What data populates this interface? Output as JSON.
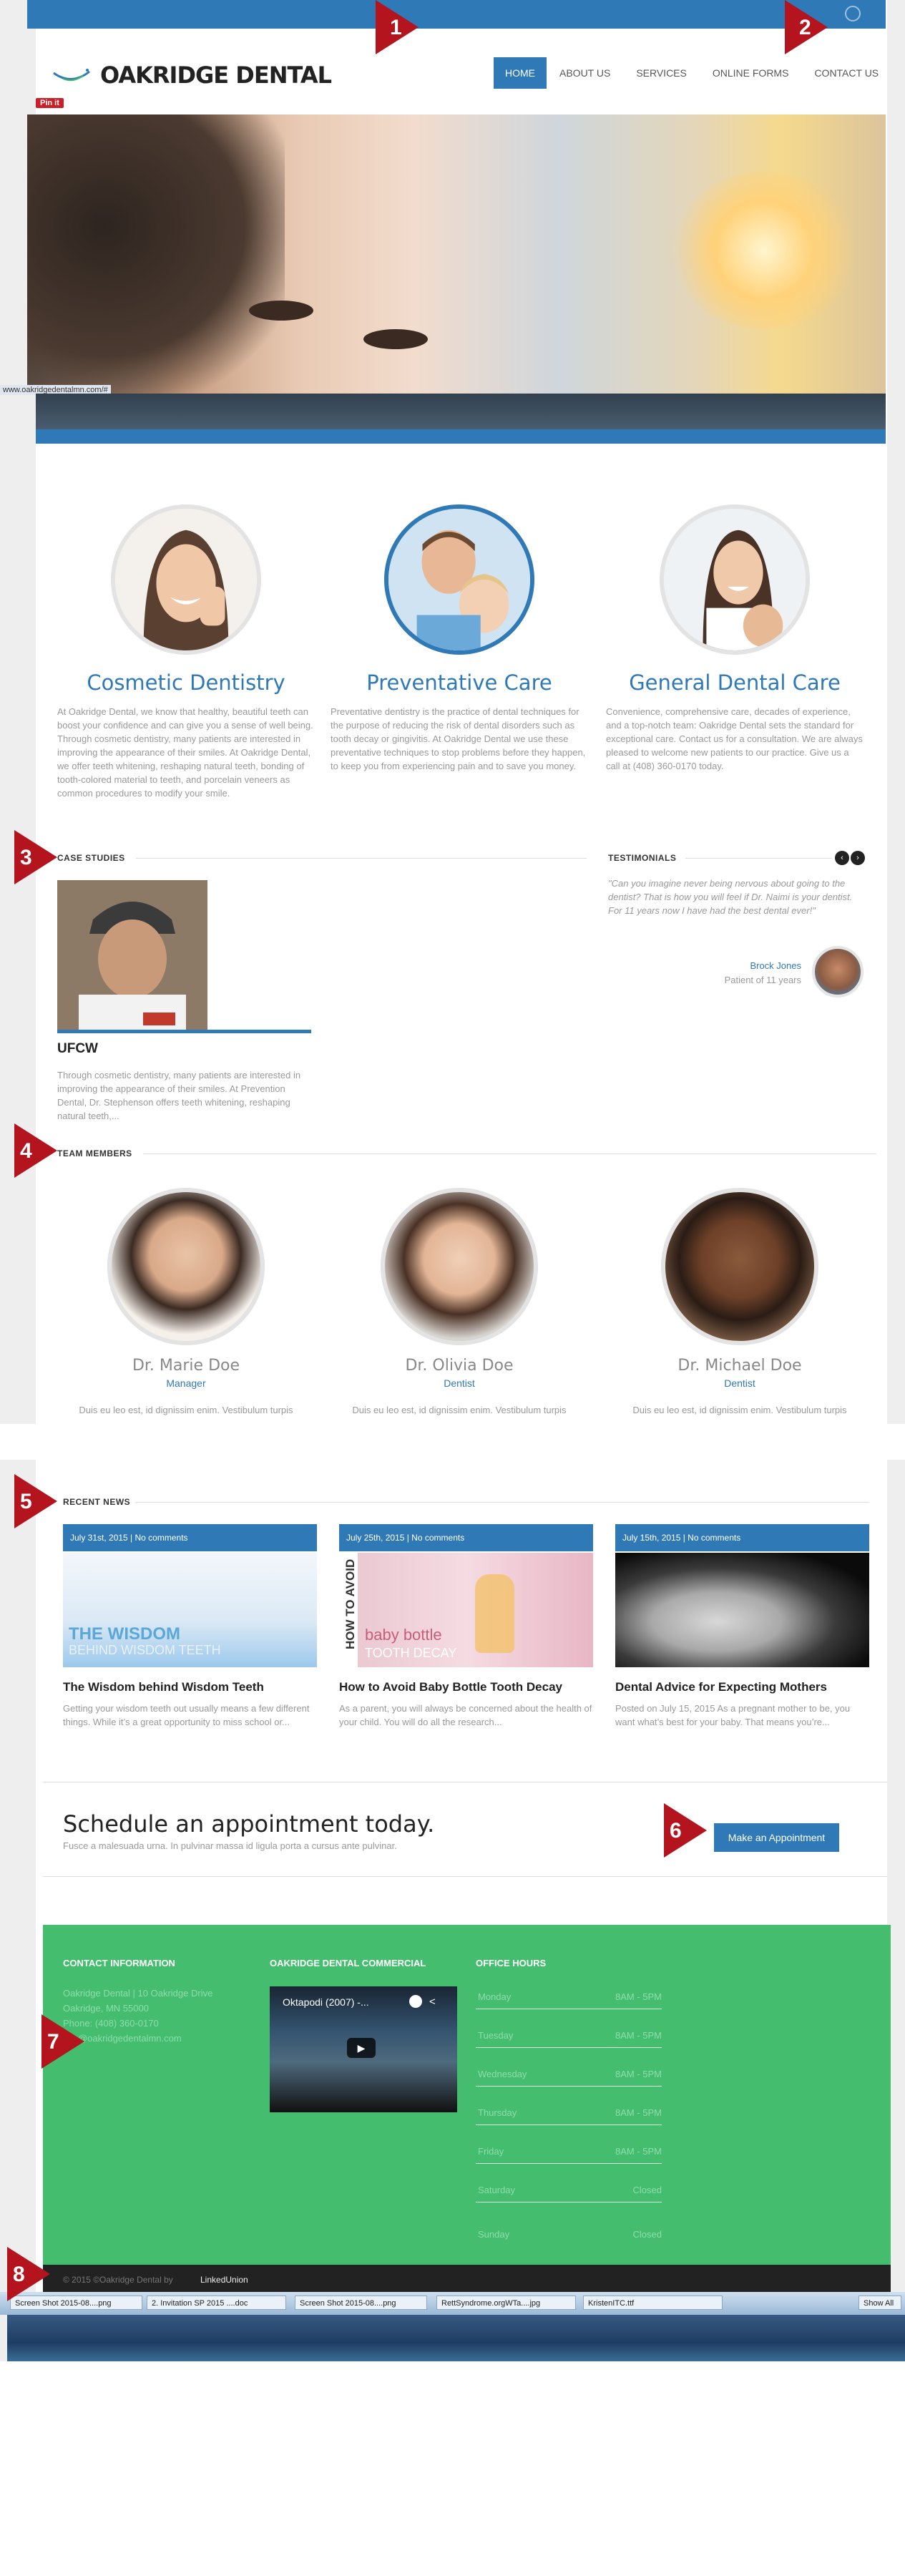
{
  "site": {
    "logo_text": "OAKRIDGE DENTAL",
    "pinit_label": "Pin it"
  },
  "nav": [
    "HOME",
    "ABOUT US",
    "SERVICES",
    "ONLINE FORMS",
    "CONTACT US"
  ],
  "status_url": "www.oakridgedentalmn.com/#",
  "services": [
    {
      "title": "Cosmetic Dentistry",
      "text": "At Oakridge Dental, we know that healthy, beautiful teeth can boost your confidence and can give you a sense of well being. Through cosmetic dentistry, many patients are interested in improving the appearance of their smiles. At Oakridge Dental, we offer teeth whitening, reshaping natural teeth, bonding of tooth-colored material to teeth, and porcelain veneers as common procedures to modify your smile."
    },
    {
      "title": "Preventative Care",
      "text": "Preventative dentistry is the practice of dental techniques for the purpose of reducing the risk of dental disorders such as tooth decay or gingivitis. At Oakridge Dental we use these preventative techniques to stop problems before they happen, to keep you from experiencing pain and to save you money."
    },
    {
      "title": "General Dental Care",
      "text": "Convenience, comprehensive care, decades of experience, and a top-notch team: Oakridge Dental sets the standard for exceptional care. Contact us for a consultation. We are always pleased to welcome new patients to our practice. Give us a call at (408) 360-0170 today."
    }
  ],
  "case_studies": {
    "heading": "CASE STUDIES",
    "title": "UFCW",
    "text": "Through cosmetic dentistry, many patients are interested in improving the appearance of their smiles. At Prevention Dental, Dr. Stephenson offers teeth whitening, reshaping natural teeth,..."
  },
  "testimonials": {
    "heading": "TESTIMONIALS",
    "quote": "\"Can you imagine never being nervous about going to the dentist? That is how you will feel if Dr. Naimi is your dentist. For 11 years now I have had the best dental ever!\"",
    "name": "Brock Jones",
    "role": "Patient of 11 years",
    "prev": "‹",
    "next": "›"
  },
  "team": {
    "heading": "TEAM MEMBERS",
    "members": [
      {
        "name": "Dr. Marie Doe",
        "role": "Manager",
        "text": "Duis eu leo est, id dignissim enim. Vestibulum turpis"
      },
      {
        "name": "Dr. Olivia Doe",
        "role": "Dentist",
        "text": "Duis eu leo est, id dignissim enim. Vestibulum turpis"
      },
      {
        "name": "Dr. Michael Doe",
        "role": "Dentist",
        "text": "Duis eu leo est, id dignissim enim. Vestibulum turpis"
      }
    ]
  },
  "news": {
    "heading": "RECENT NEWS",
    "items": [
      {
        "date": "July 31st, 2015 | No comments",
        "img_text": "THE WISDOM",
        "img_sub": "BEHIND WISDOM TEETH",
        "title": "The Wisdom behind Wisdom Teeth",
        "text": "Getting your wisdom teeth out usually means a few different things. While it’s a great opportunity to miss school or..."
      },
      {
        "date": "July 25th, 2015 | No comments",
        "img_text": "HOW TO AVOID",
        "img_sub": "baby bottle",
        "img_sub2": "TOOTH DECAY",
        "title": "How to Avoid Baby Bottle Tooth Decay",
        "text": "As a parent, you will always be concerned about the health of your child. You will do all the research..."
      },
      {
        "date": "July 15th, 2015 | No comments",
        "title": "Dental Advice for Expecting Mothers",
        "text": "Posted on July 15, 2015 As a pregnant mother to be, you want what’s best for your baby. That means you’re..."
      }
    ]
  },
  "appointment": {
    "title": "Schedule an appointment today.",
    "subtitle": "Fusce a malesuada urna. In pulvinar massa id ligula porta a cursus ante pulvinar.",
    "button": "Make an Appointment"
  },
  "footer": {
    "contact_heading": "CONTACT INFORMATION",
    "contact_lines": [
      "Oakridge Dental | 10 Oakridge Drive",
      "Oakridge, MN 55000",
      "Phone: (408) 360-0170",
      "info@oakridgedentalmn.com"
    ],
    "commercial_heading": "OAKRIDGE DENTAL COMMERCIAL",
    "video_title": "Oktapodi (2007) -...",
    "hours_heading": "OFFICE HOURS",
    "hours": [
      {
        "day": "Monday",
        "time": "8AM - 5PM"
      },
      {
        "day": "Tuesday",
        "time": "8AM - 5PM"
      },
      {
        "day": "Wednesday",
        "time": "8AM - 5PM"
      },
      {
        "day": "Thursday",
        "time": "8AM - 5PM"
      },
      {
        "day": "Friday",
        "time": "8AM - 5PM"
      },
      {
        "day": "Saturday",
        "time": "Closed"
      },
      {
        "day": "Sunday",
        "time": "Closed"
      }
    ],
    "copyright": "© 2015 ©Oakridge Dental by",
    "copyright_link": "LinkedUnion"
  },
  "taskbar": {
    "items": [
      "Screen Shot 2015-08....png",
      "2. Invitation SP 2015 ....doc",
      "Screen Shot 2015-08....png",
      "RettSyndrome.orgWTa....jpg",
      "KristenITC.ttf"
    ],
    "show_all": "Show All"
  },
  "markers": [
    "1",
    "2",
    "3",
    "4",
    "5",
    "6",
    "7",
    "8"
  ],
  "colors": {
    "brand_blue": "#2f79b6",
    "footer_green": "#44bd6f",
    "marker_red": "#b3141e"
  }
}
